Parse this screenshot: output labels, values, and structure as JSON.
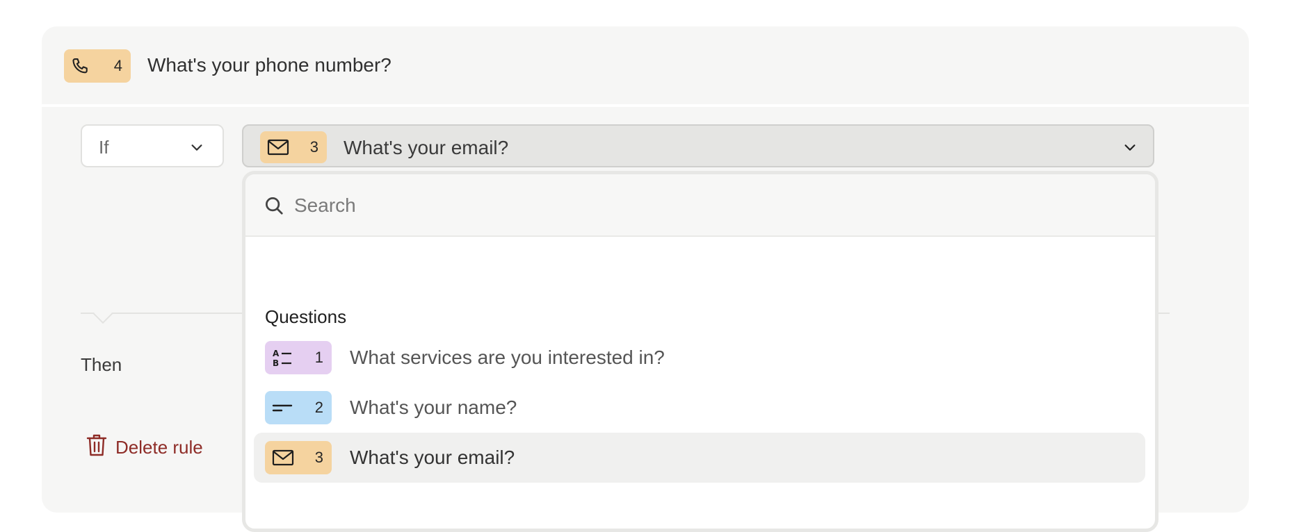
{
  "header": {
    "icon": "phone-icon",
    "number": "4",
    "title": "What's your phone number?",
    "badge_color": "#f5d39f"
  },
  "condition": {
    "operator": "If",
    "selected": {
      "icon": "mail-icon",
      "number": "3",
      "label": "What's your email?",
      "badge_color": "#f5d39f"
    }
  },
  "dropdown": {
    "search_placeholder": "Search",
    "section_title": "Questions",
    "options": [
      {
        "icon": "multiple-choice-icon",
        "number": "1",
        "label": "What services are you interested in?",
        "badge_color": "#e5cff1"
      },
      {
        "icon": "short-text-icon",
        "number": "2",
        "label": "What's your name?",
        "badge_color": "#b9ddf7"
      },
      {
        "icon": "mail-icon",
        "number": "3",
        "label": "What's your email?",
        "badge_color": "#f5d39f",
        "highlighted": true
      }
    ]
  },
  "then_label": "Then",
  "delete_label": "Delete rule",
  "colors": {
    "delete_red": "#8e2c27",
    "card_bg": "#f6f6f5"
  }
}
